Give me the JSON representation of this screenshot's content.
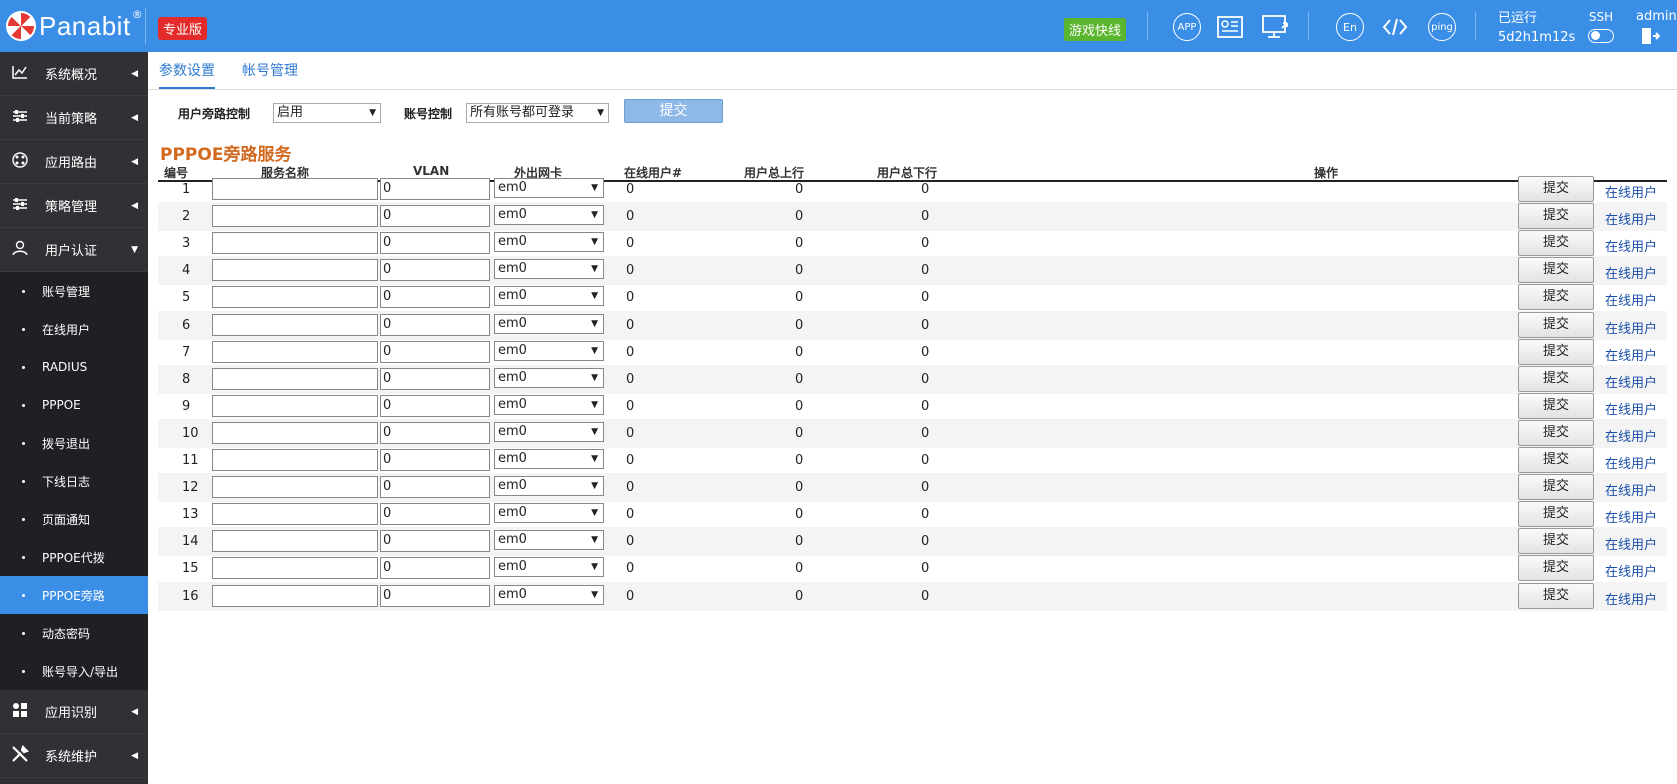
{
  "header": {
    "brand": "Panabit",
    "reg_mark": "®",
    "edition": "专业版",
    "game_badge": "游戏快线",
    "uptime_label": "已运行",
    "uptime_value": "5d2h1m12s",
    "ssh_label": "SSH",
    "user": "admin",
    "icons": [
      "app-icon",
      "report-icon",
      "monitor-upload-icon",
      "en-language-icon",
      "code-icon",
      "ping-icon",
      "logout-icon"
    ],
    "icon_texts": {
      "app": "APP",
      "en": "En",
      "ping": "ping"
    }
  },
  "sidebar": {
    "items": [
      {
        "label": "系统概况",
        "icon": "chart-line-icon"
      },
      {
        "label": "当前策略",
        "icon": "sliders-icon"
      },
      {
        "label": "应用路由",
        "icon": "network-icon"
      },
      {
        "label": "策略管理",
        "icon": "sliders-icon"
      },
      {
        "label": "用户认证",
        "icon": "user-icon",
        "expanded": true
      }
    ],
    "sub_items": [
      "账号管理",
      "在线用户",
      "RADIUS",
      "PPPOE",
      "拨号退出",
      "下线日志",
      "页面通知",
      "PPPOE代拨",
      "PPPOE旁路",
      "动态密码",
      "账号导入/导出"
    ],
    "active_sub": "PPPOE旁路",
    "bottom_items": [
      {
        "label": "应用识别",
        "icon": "grid-icon"
      },
      {
        "label": "系统维护",
        "icon": "tools-icon"
      }
    ]
  },
  "tabs": [
    {
      "label": "参数设置",
      "active": true
    },
    {
      "label": "帐号管理",
      "active": false
    }
  ],
  "filters": {
    "bypass_label": "用户旁路控制",
    "bypass_value": "启用",
    "account_label": "账号控制",
    "account_value": "所有账号都可登录",
    "submit_label": "提交"
  },
  "section_title": "PPPOE旁路服务",
  "table": {
    "headers": [
      "编号",
      "服务名称",
      "VLAN",
      "外出网卡",
      "在线用户#",
      "用户总上行",
      "用户总下行",
      "操作"
    ],
    "rows": [
      {
        "id": "1",
        "name": "",
        "vlan": "0",
        "iface": "em0",
        "online": "0",
        "up": "0",
        "down": "0"
      },
      {
        "id": "2",
        "name": "",
        "vlan": "0",
        "iface": "em0",
        "online": "0",
        "up": "0",
        "down": "0"
      },
      {
        "id": "3",
        "name": "",
        "vlan": "0",
        "iface": "em0",
        "online": "0",
        "up": "0",
        "down": "0"
      },
      {
        "id": "4",
        "name": "",
        "vlan": "0",
        "iface": "em0",
        "online": "0",
        "up": "0",
        "down": "0"
      },
      {
        "id": "5",
        "name": "",
        "vlan": "0",
        "iface": "em0",
        "online": "0",
        "up": "0",
        "down": "0"
      },
      {
        "id": "6",
        "name": "",
        "vlan": "0",
        "iface": "em0",
        "online": "0",
        "up": "0",
        "down": "0"
      },
      {
        "id": "7",
        "name": "",
        "vlan": "0",
        "iface": "em0",
        "online": "0",
        "up": "0",
        "down": "0"
      },
      {
        "id": "8",
        "name": "",
        "vlan": "0",
        "iface": "em0",
        "online": "0",
        "up": "0",
        "down": "0"
      },
      {
        "id": "9",
        "name": "",
        "vlan": "0",
        "iface": "em0",
        "online": "0",
        "up": "0",
        "down": "0"
      },
      {
        "id": "10",
        "name": "",
        "vlan": "0",
        "iface": "em0",
        "online": "0",
        "up": "0",
        "down": "0"
      },
      {
        "id": "11",
        "name": "",
        "vlan": "0",
        "iface": "em0",
        "online": "0",
        "up": "0",
        "down": "0"
      },
      {
        "id": "12",
        "name": "",
        "vlan": "0",
        "iface": "em0",
        "online": "0",
        "up": "0",
        "down": "0"
      },
      {
        "id": "13",
        "name": "",
        "vlan": "0",
        "iface": "em0",
        "online": "0",
        "up": "0",
        "down": "0"
      },
      {
        "id": "14",
        "name": "",
        "vlan": "0",
        "iface": "em0",
        "online": "0",
        "up": "0",
        "down": "0"
      },
      {
        "id": "15",
        "name": "",
        "vlan": "0",
        "iface": "em0",
        "online": "0",
        "up": "0",
        "down": "0"
      },
      {
        "id": "16",
        "name": "",
        "vlan": "0",
        "iface": "em0",
        "online": "0",
        "up": "0",
        "down": "0"
      }
    ],
    "submit_label": "提交",
    "online_link": "在线用户"
  },
  "colors": {
    "accent": "#3a8ee6",
    "sidebar": "#2f3135",
    "section_title": "#d2691e",
    "link": "#1a4fa8",
    "edition_badge": "#e32b2b",
    "game_badge": "#5ab62e"
  }
}
